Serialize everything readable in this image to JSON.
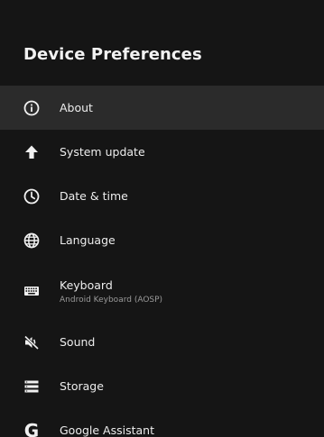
{
  "header": {
    "title": "Device Preferences"
  },
  "menu": {
    "items": [
      {
        "label": "About",
        "icon": "info-icon",
        "selected": true
      },
      {
        "label": "System update",
        "icon": "arrow-up-icon"
      },
      {
        "label": "Date & time",
        "icon": "clock-icon"
      },
      {
        "label": "Language",
        "icon": "globe-icon"
      },
      {
        "label": "Keyboard",
        "sublabel": "Android Keyboard (AOSP)",
        "icon": "keyboard-icon"
      },
      {
        "label": "Sound",
        "icon": "sound-muted-icon"
      },
      {
        "label": "Storage",
        "icon": "storage-icon"
      },
      {
        "label": "Google Assistant",
        "icon": "google-icon",
        "glyph": "G"
      }
    ]
  }
}
